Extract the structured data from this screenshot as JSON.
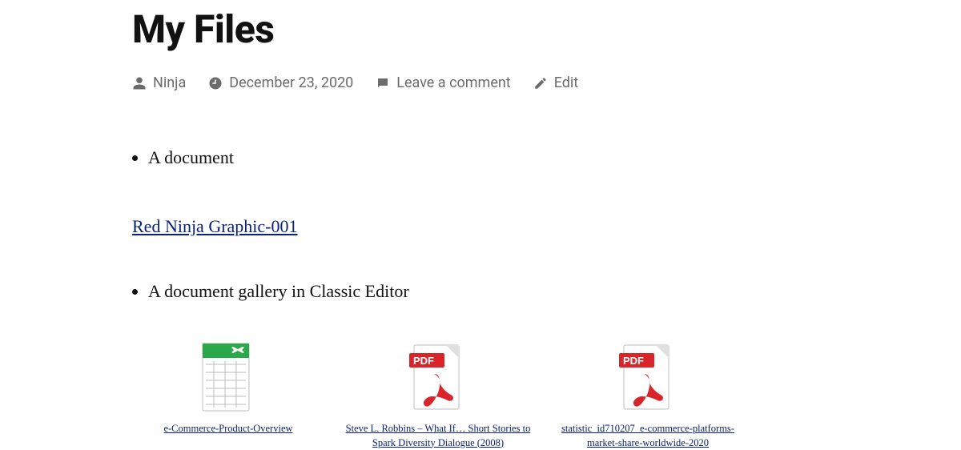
{
  "title": "My Files",
  "meta": {
    "author": "Ninja",
    "date": "December 23, 2020",
    "comment": "Leave a comment",
    "edit": "Edit"
  },
  "list": {
    "item1": "A document",
    "item2": "A document gallery in Classic Editor"
  },
  "docLink": "Red Ninja Graphic-001",
  "gallery": [
    {
      "type": "xls",
      "caption": "e-Commerce-Product-Overview"
    },
    {
      "type": "pdf",
      "caption": "Steve L. Robbins – What If… Short Stories to Spark Diversity Dialogue (2008)"
    },
    {
      "type": "pdf",
      "caption": "statistic_id710207_e-commerce-platforms-market-share-worldwide-2020"
    }
  ]
}
